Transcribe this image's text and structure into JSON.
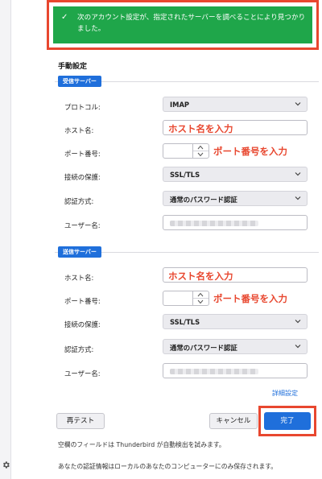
{
  "banner": {
    "message": "次のアカウント設定が、指定されたサーバーを調べることにより見つかりました。",
    "color": "#1fa64a"
  },
  "manual": {
    "title": "手動設定"
  },
  "incoming": {
    "legend": "受信サーバー",
    "protocol_label": "プロトコル:",
    "protocol_value": "IMAP",
    "host_label": "ホスト名:",
    "host_value": "ホスト名を入力",
    "port_label": "ポート番号:",
    "port_note": "ポート番号を入力",
    "security_label": "接続の保護:",
    "security_value": "SSL/TLS",
    "auth_label": "認証方式:",
    "auth_value": "通常のパスワード認証",
    "user_label": "ユーザー名:"
  },
  "outgoing": {
    "legend": "送信サーバー",
    "host_label": "ホスト名:",
    "host_value": "ホスト名を入力",
    "port_label": "ポート番号:",
    "port_note": "ポート番号を入力",
    "security_label": "接続の保護:",
    "security_value": "SSL/TLS",
    "auth_label": "認証方式:",
    "auth_value": "通常のパスワード認証",
    "user_label": "ユーザー名:"
  },
  "actions": {
    "advanced": "詳細設定",
    "retest": "再テスト",
    "cancel": "キャンセル",
    "done": "完了"
  },
  "notes": {
    "autodetect": "空欄のフィールドは Thunderbird が自動検出を試みます。",
    "local_storage": "あなたの認証情報はローカルのあなたのコンピューターにのみ保存されます。"
  },
  "colors": {
    "accent": "#1f6fdb",
    "highlight": "#e8472f"
  },
  "icons": {
    "banner": "check-icon",
    "sidebar": "gear-icon"
  }
}
